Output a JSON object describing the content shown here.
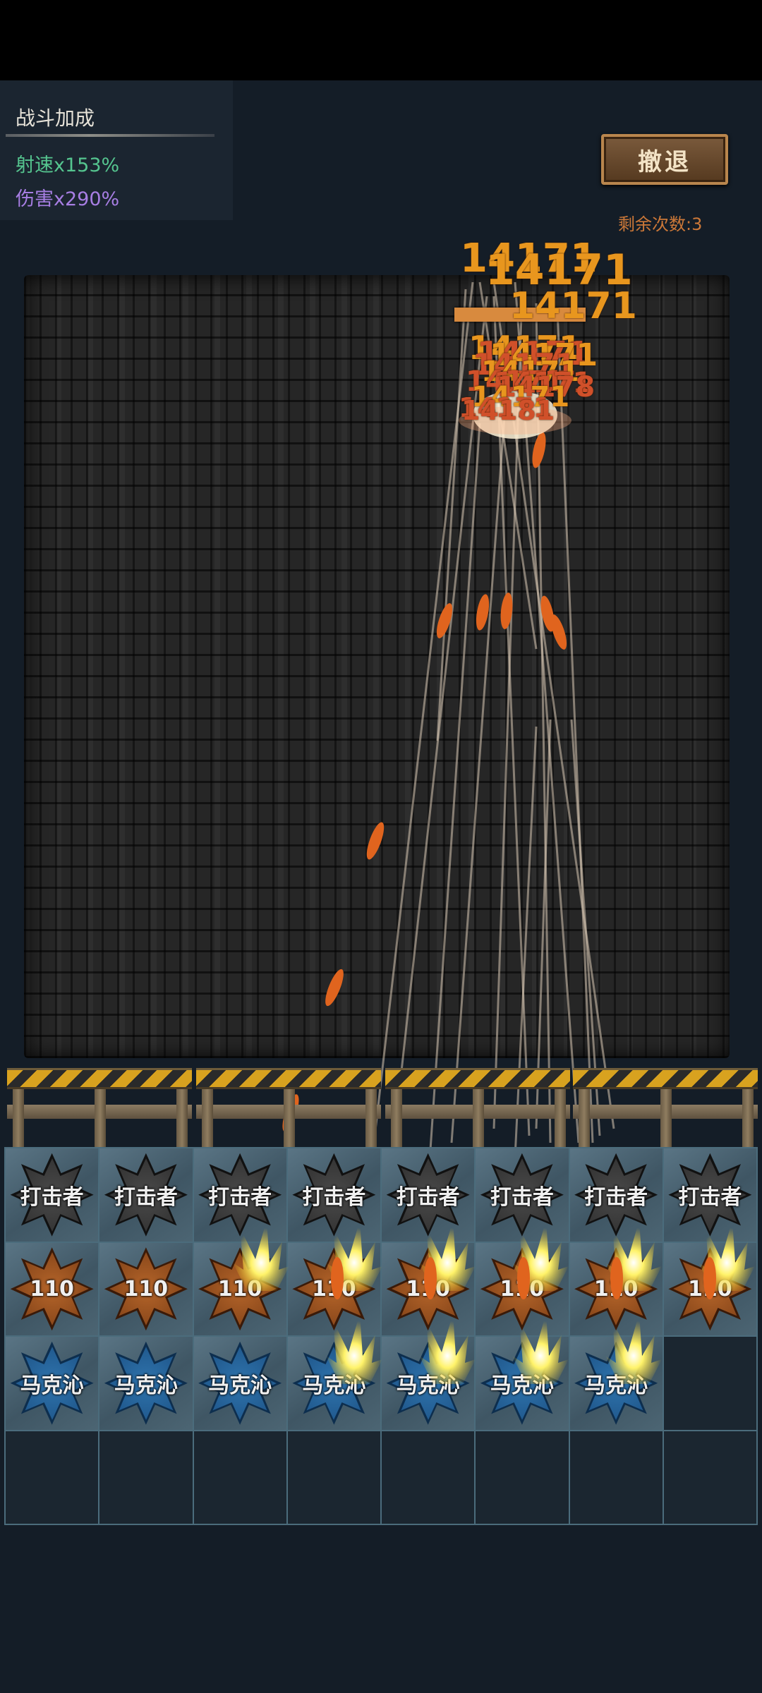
{
  "bonus": {
    "title": "战斗加成",
    "fire_rate": "射速x153%",
    "damage": "伤害x290%"
  },
  "retreat": {
    "label": "撤退",
    "remaining": "剩余次数:3"
  },
  "damage_numbers": [
    "14171",
    "14171",
    "14171",
    "14171",
    "14171",
    "14171",
    "14171",
    "14171",
    "14171",
    "14171",
    "14178",
    "14171",
    "14171",
    "14181"
  ],
  "grid": {
    "rows": [
      [
        "打击者",
        "打击者",
        "打击者",
        "打击者",
        "打击者",
        "打击者",
        "打击者",
        "打击者"
      ],
      [
        "110",
        "110",
        "110",
        "110",
        "110",
        "110",
        "110",
        "110"
      ],
      [
        "马克沁",
        "马克沁",
        "马克沁",
        "马克沁",
        "马克沁",
        "马克沁",
        "马克沁",
        ""
      ],
      [
        "",
        "",
        "",
        "",
        "",
        "",
        "",
        ""
      ]
    ]
  },
  "colors": {
    "fire_rate": "#55c58f",
    "damage": "#a77ee3",
    "damage_number": "#e8961e",
    "damage_number_crit": "#d0502a",
    "striker_badge": "#3a3a3a",
    "level_badge": "#9a5320",
    "maxim_badge": "#225f97"
  },
  "icons": [
    "striker-turret-icon",
    "level-turret-icon",
    "maxim-turret-icon",
    "barricade-icon",
    "bullet-icon"
  ]
}
